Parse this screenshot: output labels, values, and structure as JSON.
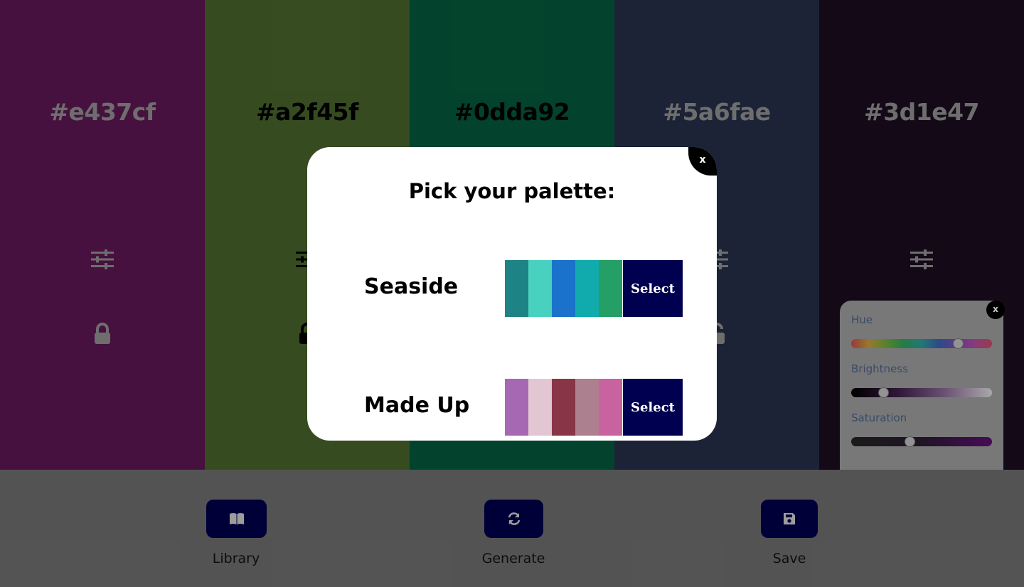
{
  "colors": [
    {
      "hex": "#e437cf",
      "bg": "#5b1651",
      "text_color": "#8e8e8e",
      "lock": "locked"
    },
    {
      "hex": "#a2f45f",
      "bg": "#466229",
      "text_color": "#000000",
      "lock": "unlocked"
    },
    {
      "hex": "#0dda92",
      "bg": "#05573a",
      "text_color": "#000000",
      "lock": "unlocked"
    },
    {
      "hex": "#5a6fae",
      "bg": "#252d46",
      "text_color": "#8e8e8e",
      "lock": "unlocked"
    },
    {
      "hex": "#3d1e47",
      "bg": "#1a0c1e",
      "text_color": "#8e8e8e",
      "lock": "unlocked"
    }
  ],
  "modal": {
    "title": "Pick your palette:",
    "close_label": "x",
    "palettes": [
      {
        "name": "Seaside",
        "select_label": "Select",
        "swatches": [
          "#1e8385",
          "#49d1bf",
          "#1a72cb",
          "#12abad",
          "#24a067"
        ]
      },
      {
        "name": "Made Up",
        "select_label": "Select",
        "swatches": [
          "#a668b2",
          "#e2c7d3",
          "#893548",
          "#ad8090",
          "#c863a0"
        ]
      }
    ]
  },
  "sliders_panel": {
    "close_label": "x",
    "hue_label": "Hue",
    "brightness_label": "Brightness",
    "saturation_label": "Saturation",
    "hue_value": 0.78,
    "brightness_value": 0.21,
    "saturation_value": 0.41
  },
  "panel": {
    "library_label": "Library",
    "generate_label": "Generate",
    "save_label": "Save",
    "library_icon": "book-icon",
    "generate_icon": "refresh-icon",
    "save_icon": "floppy-icon"
  }
}
